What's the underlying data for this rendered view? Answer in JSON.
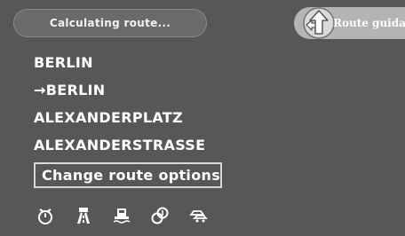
{
  "header": {
    "status_text": "Calculating route...",
    "guidance_label": "Route guidance"
  },
  "route_list": {
    "items": [
      {
        "prefix": "",
        "label": "BERLIN"
      },
      {
        "prefix": "→",
        "label": "BERLIN"
      },
      {
        "prefix": "",
        "label": "ALEXANDERPLATZ"
      },
      {
        "prefix": "",
        "label": "ALEXANDERSTRASSE"
      }
    ],
    "options_button": "Change route options"
  },
  "toolbar": {
    "icons": [
      "timer-icon",
      "motorway-icon",
      "ferry-icon",
      "toll-icon",
      "car-train-icon"
    ]
  },
  "colors": {
    "background": "#575757",
    "text": "#ffffff",
    "badge": "#b4b4b4"
  }
}
